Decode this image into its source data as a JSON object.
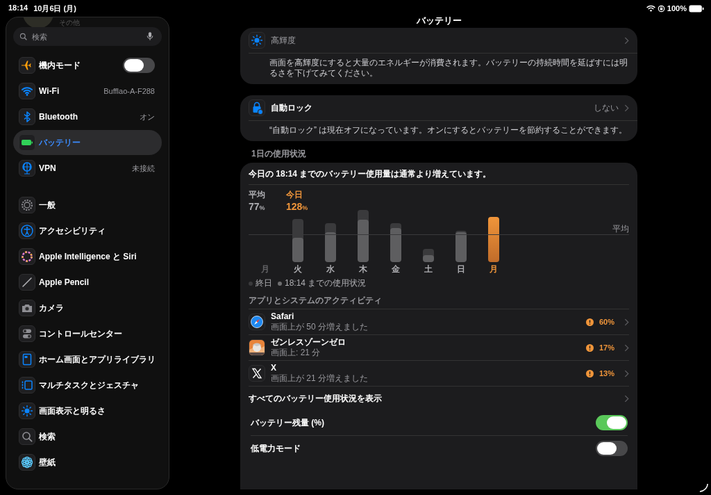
{
  "status_bar": {
    "time": "18:14",
    "date": "10月6日 (月)",
    "battery": "100%"
  },
  "sidebar": {
    "account_subtitle": "その他",
    "search": {
      "placeholder": "検索"
    },
    "groups": [
      [
        {
          "label": "機内モード",
          "kind": "toggle",
          "on": false,
          "selected": false
        },
        {
          "label": "Wi-Fi",
          "kind": "value",
          "value": "Bufflao-A-F288",
          "selected": false
        },
        {
          "label": "Bluetooth",
          "kind": "value",
          "value": "オン",
          "selected": false
        },
        {
          "label": "バッテリー",
          "kind": "link",
          "selected": true
        },
        {
          "label": "VPN",
          "kind": "value",
          "value": "未接続",
          "selected": false
        }
      ],
      [
        {
          "label": "一般",
          "kind": "link",
          "selected": false
        },
        {
          "label": "アクセシビリティ",
          "kind": "link",
          "selected": false
        },
        {
          "label": "Apple Intelligence と Siri",
          "kind": "link",
          "selected": false
        },
        {
          "label": "Apple Pencil",
          "kind": "link",
          "selected": false
        },
        {
          "label": "カメラ",
          "kind": "link",
          "selected": false
        },
        {
          "label": "コントロールセンター",
          "kind": "link",
          "selected": false
        },
        {
          "label": "ホーム画面とアプリライブラリ",
          "kind": "link",
          "selected": false
        },
        {
          "label": "マルチタスクとジェスチャ",
          "kind": "link",
          "selected": false
        },
        {
          "label": "画面表示と明るさ",
          "kind": "link",
          "selected": false
        },
        {
          "label": "検索",
          "kind": "link",
          "selected": false
        },
        {
          "label": "壁紙",
          "kind": "link",
          "selected": false
        }
      ]
    ]
  },
  "page": {
    "title": "バッテリー",
    "cards": [
      {
        "label": "高輝度",
        "disabled": true,
        "note": "画面を高輝度にすると大量のエネルギーが消費されます。バッテリーの持続時間を延ばすには明るさを下げてみてください。"
      },
      {
        "label": "自動ロック",
        "disabled": false,
        "value": "しない",
        "note": "“自動ロック” は現在オフになっています。オンにするとバッテリーを節約することができます。"
      }
    ],
    "usage": {
      "heading": "1日の使用状況",
      "summary": "今日の 18:14 までのバッテリー使用量は通常より増えています。",
      "average": {
        "label": "平均",
        "value": "77",
        "unit": "%"
      },
      "today": {
        "label": "今日",
        "value": "128",
        "unit": "%"
      },
      "average_line_label": "平均",
      "days": [
        {
          "label": "月",
          "selected": false
        },
        {
          "label": "火",
          "selected": false
        },
        {
          "label": "水",
          "selected": false
        },
        {
          "label": "木",
          "selected": false
        },
        {
          "label": "金",
          "selected": false
        },
        {
          "label": "土",
          "selected": false
        },
        {
          "label": "日",
          "selected": false
        },
        {
          "label": "月",
          "selected": true
        }
      ],
      "legend": [
        "終日",
        "18:14 までの使用状況"
      ],
      "activity_heading": "アプリとシステムのアクティビティ",
      "apps": [
        {
          "name": "Safari",
          "detail": "画面上が 50 分増えました",
          "share": "60%",
          "warning": true
        },
        {
          "name": "ゼンレスゾーンゼロ",
          "detail": "画面上: 21 分",
          "share": "17%",
          "warning": true
        },
        {
          "name": "X",
          "detail": "画面上が 21 分増えました",
          "share": "13%",
          "warning": true
        }
      ],
      "show_all": "すべてのバッテリー使用状況を表示",
      "toggles": [
        {
          "label": "バッテリー残量 (%)",
          "on": true
        },
        {
          "label": "低電力モード",
          "on": false
        }
      ]
    }
  }
}
